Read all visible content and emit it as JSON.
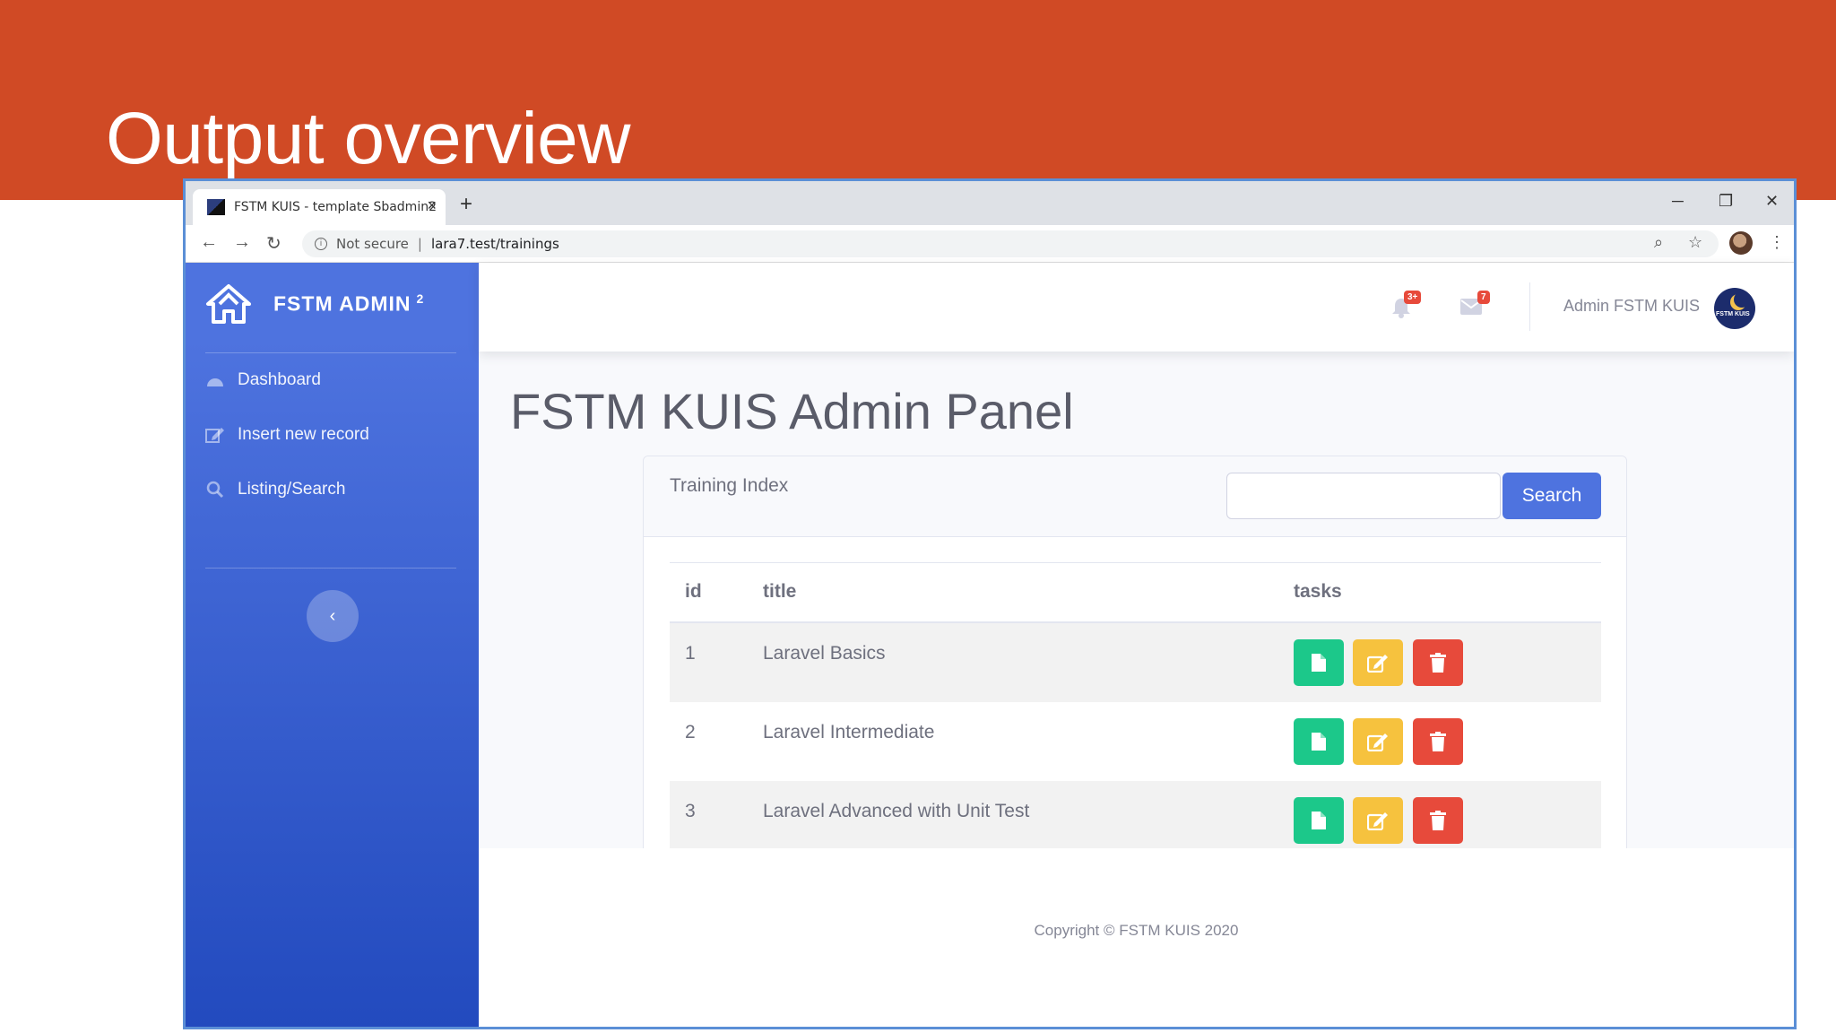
{
  "slide": {
    "title": "Output overview"
  },
  "browser": {
    "tab_title": "FSTM KUIS - template Sbadmin2",
    "tab_close": "×",
    "new_tab": "+",
    "not_secure": "Not secure",
    "separator": "|",
    "url": "lara7.test/trainings",
    "minimize": "─",
    "restore": "❐",
    "close": "✕"
  },
  "sidebar": {
    "brand": "FSTM ADMIN",
    "brand_sup": "2",
    "items": [
      {
        "label": "Dashboard",
        "icon": "tachometer-icon"
      },
      {
        "label": "Insert new record",
        "icon": "edit-icon"
      },
      {
        "label": "Listing/Search",
        "icon": "search-icon"
      }
    ],
    "toggle": "‹"
  },
  "topbar": {
    "alerts_badge": "3+",
    "messages_badge": "7",
    "user_name": "Admin FSTM KUIS",
    "avatar_text": "FSTM KUIS"
  },
  "page": {
    "title": "FSTM KUIS Admin Panel",
    "card_title": "Training Index",
    "search_value": "",
    "search_button": "Search",
    "columns": [
      "id",
      "title",
      "tasks"
    ],
    "rows": [
      {
        "id": "1",
        "title": "Laravel Basics"
      },
      {
        "id": "2",
        "title": "Laravel Intermediate"
      },
      {
        "id": "3",
        "title": "Laravel Advanced with Unit Test"
      }
    ]
  },
  "footer": {
    "copyright": "Copyright © FSTM KUIS 2020"
  },
  "colors": {
    "slide_header": "#d04a25",
    "sidebar_top": "#4e73df",
    "sidebar_bottom": "#224abe",
    "primary": "#4e73df",
    "success": "#1cc88a",
    "warning": "#f6c23e",
    "danger": "#e74a3b"
  }
}
